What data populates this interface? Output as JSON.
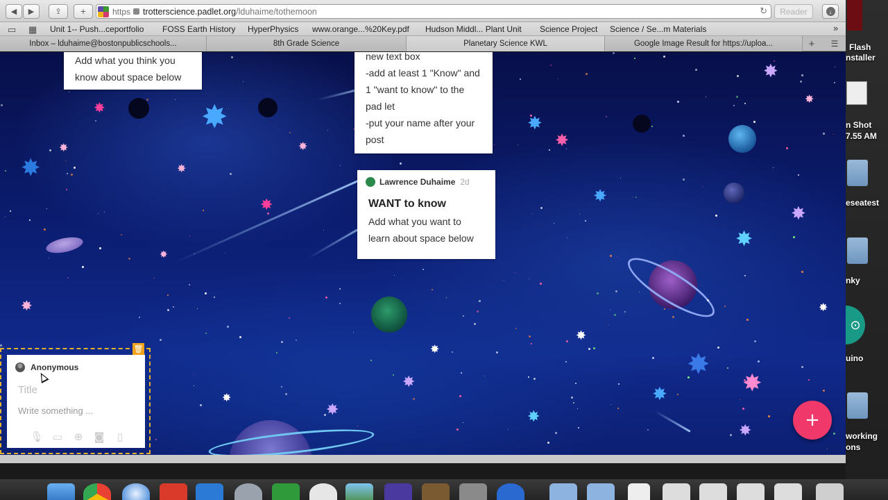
{
  "browser": {
    "url_scheme": "https",
    "url_host": "trotterscience.padlet.org",
    "url_path": "/lduhaime/tothemoon",
    "reader_label": "Reader",
    "bookmarks": [
      "Unit 1-- Push...ceportfolio",
      "FOSS Earth History",
      "HyperPhysics",
      "www.orange...%20Key.pdf",
      "Hudson Middl... Plant Unit",
      "Science Project",
      "Science / Se...m Materials"
    ],
    "tabs": [
      "Inbox – lduhaime@bostonpublicschools...",
      "8th Grade Science",
      "Planetary Science KWL",
      "Google Image Result for https://uploa..."
    ],
    "icons": {
      "back": "chevron-left-icon",
      "forward": "chevron-right-icon",
      "share": "share-icon",
      "new_tab": "plus-icon",
      "reload": "reload-icon",
      "downloads": "download-icon",
      "bookmarks": "book-icon",
      "top_sites": "grid-icon"
    }
  },
  "padlet": {
    "posts": [
      {
        "body": [
          "Add what you think you",
          "know about space below"
        ]
      },
      {
        "body": [
          "new text box",
          "-add at least 1 \"Know\" and",
          "1 \"want to know\" to the",
          "pad let",
          "-put your name after your",
          "post"
        ]
      },
      {
        "author": "Lawrence Duhaime",
        "time": "2d",
        "title": "WANT to know",
        "body": [
          "Add what you want to",
          "learn about space below"
        ]
      }
    ],
    "new_post": {
      "author": "Anonymous",
      "title_placeholder": "Title",
      "body_placeholder": "Write something ...",
      "attach_icons": [
        "microphone-icon",
        "video-icon",
        "link-icon",
        "camera-icon",
        "document-icon"
      ]
    },
    "fab_label": "+",
    "colors": {
      "fab": "#f0386b",
      "new_post_border": "#e3b12c"
    }
  },
  "desktop": {
    "labels": [
      "Flash",
      "nstaller",
      "n Shot",
      "7.55 AM",
      "eseatest",
      "nky",
      "uino",
      "working",
      "ons"
    ]
  }
}
